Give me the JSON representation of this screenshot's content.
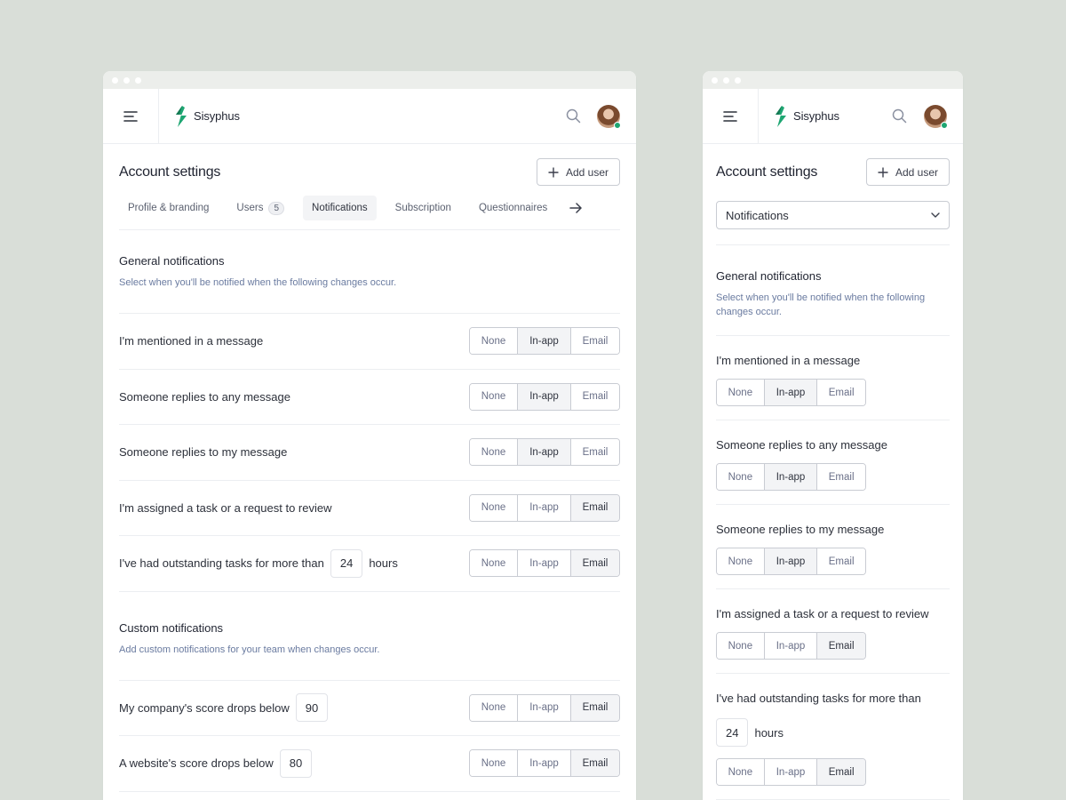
{
  "brand": {
    "name": "Sisyphus",
    "accent": "#1ea672"
  },
  "page": {
    "title": "Account settings",
    "add_user_label": "Add user"
  },
  "tabs": [
    {
      "label": "Profile & branding"
    },
    {
      "label": "Users",
      "badge": "5"
    },
    {
      "label": "Notifications",
      "active": true
    },
    {
      "label": "Subscription"
    },
    {
      "label": "Questionnaires"
    }
  ],
  "mobile": {
    "select_value": "Notifications"
  },
  "options": {
    "none": "None",
    "inapp": "In-app",
    "email": "Email"
  },
  "general": {
    "title": "General notifications",
    "desc": "Select when you'll be notified when the following changes occur.",
    "rows": [
      {
        "label": "I'm mentioned in a message",
        "selected": "In-app"
      },
      {
        "label": "Someone replies to any message",
        "selected": "In-app"
      },
      {
        "label": "Someone replies to my message",
        "selected": "In-app"
      },
      {
        "label": "I'm assigned a task or a request to review",
        "selected": "Email"
      },
      {
        "label": "I've had outstanding tasks for more than",
        "value": "24",
        "suffix": "hours",
        "selected": "Email"
      }
    ]
  },
  "custom": {
    "title": "Custom notifications",
    "desc": "Add custom notifications for your team when changes occur.",
    "rows": [
      {
        "label": "My company's score drops below",
        "value": "90",
        "selected": "Email"
      },
      {
        "label": "A website's score drops below",
        "value": "80",
        "selected": "Email"
      }
    ]
  }
}
